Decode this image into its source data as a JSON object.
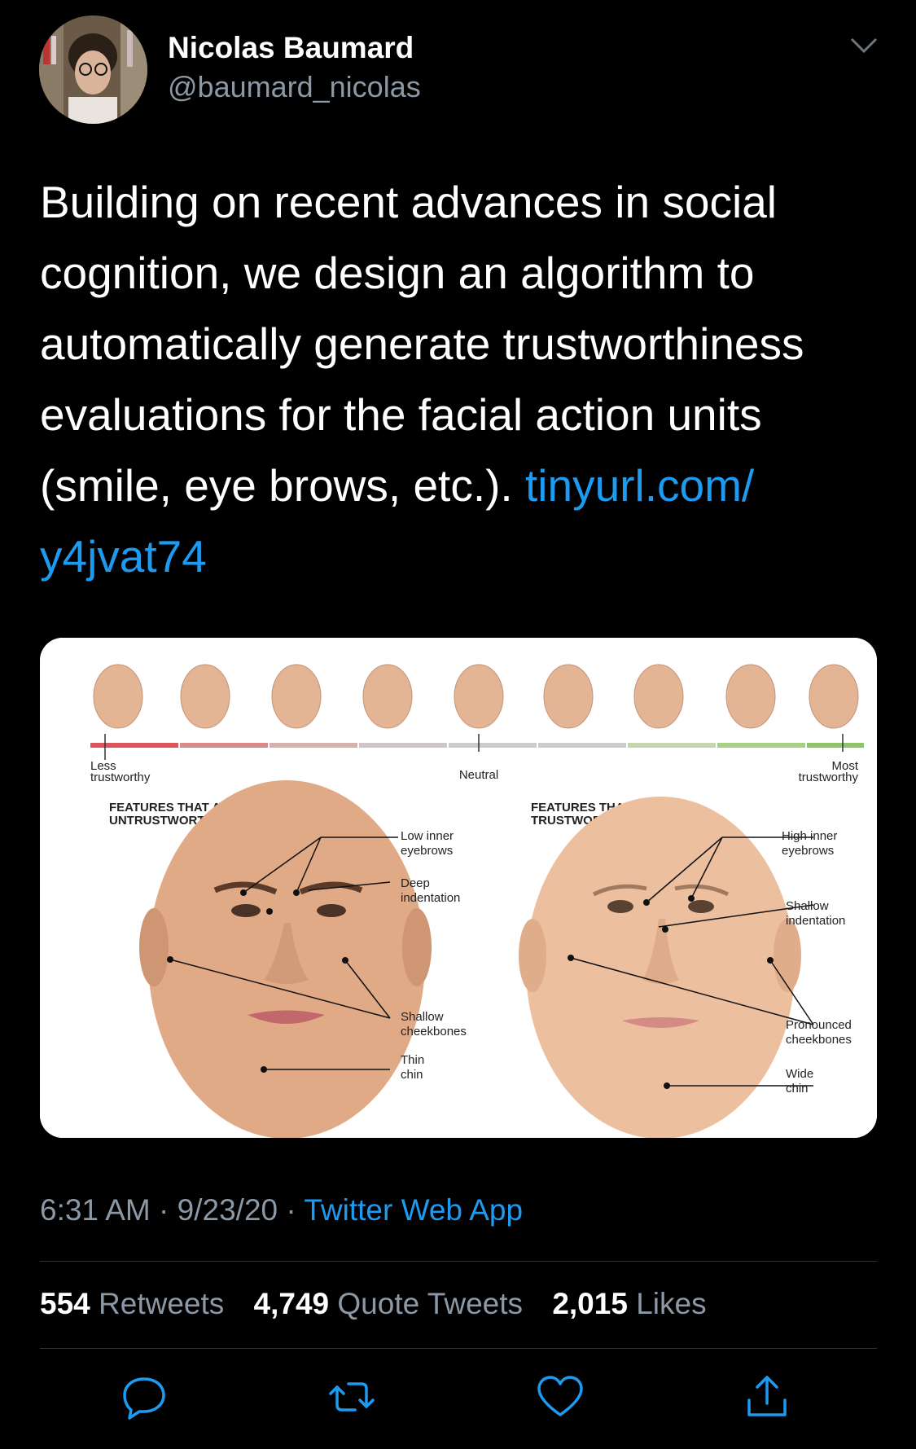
{
  "user": {
    "name": "Nicolas Baumard",
    "handle": "@baumard_nicolas"
  },
  "tweet": {
    "text": "Building on recent advances in social cognition, we design an algorithm to automatically generate trustworthiness evaluations for the facial action units (smile, eye brows, etc.).",
    "link_part1": "tinyurl.com/",
    "link_part2": "y4jvat74"
  },
  "media": {
    "scale_left": "Less\ntrustworthy",
    "scale_mid": "Neutral",
    "scale_right": "Most\ntrustworthy",
    "left_heading_1": "FEATURES THAT APPEAR",
    "left_heading_2": "UNTRUSTWORTHY",
    "right_heading_1": "FEATURES THAT APPEAR",
    "right_heading_2": "TRUSTWORTHY",
    "left_labels": [
      "Low inner",
      "eyebrows",
      "Deep",
      "indentation",
      "Shallow",
      "cheekbones",
      "Thin",
      "chin"
    ],
    "right_labels": [
      "High inner",
      "eyebrows",
      "Shallow",
      "indentation",
      "Pronounced",
      "cheekbones",
      "Wide",
      "chin"
    ]
  },
  "meta": {
    "time": "6:31 AM",
    "sep1": " · ",
    "date": "9/23/20",
    "sep2": " · ",
    "app": "Twitter Web App"
  },
  "stats": {
    "retweets_count": "554",
    "retweets_label": "Retweets",
    "quotes_count": "4,749",
    "quotes_label": "Quote Tweets",
    "likes_count": "2,015",
    "likes_label": "Likes"
  },
  "colors": {
    "background": "#000000",
    "link": "#1d9bf0",
    "secondary_text": "#8b98a5"
  },
  "icons": [
    "chevron-down-icon",
    "reply-icon",
    "retweet-icon",
    "like-icon",
    "share-icon"
  ]
}
